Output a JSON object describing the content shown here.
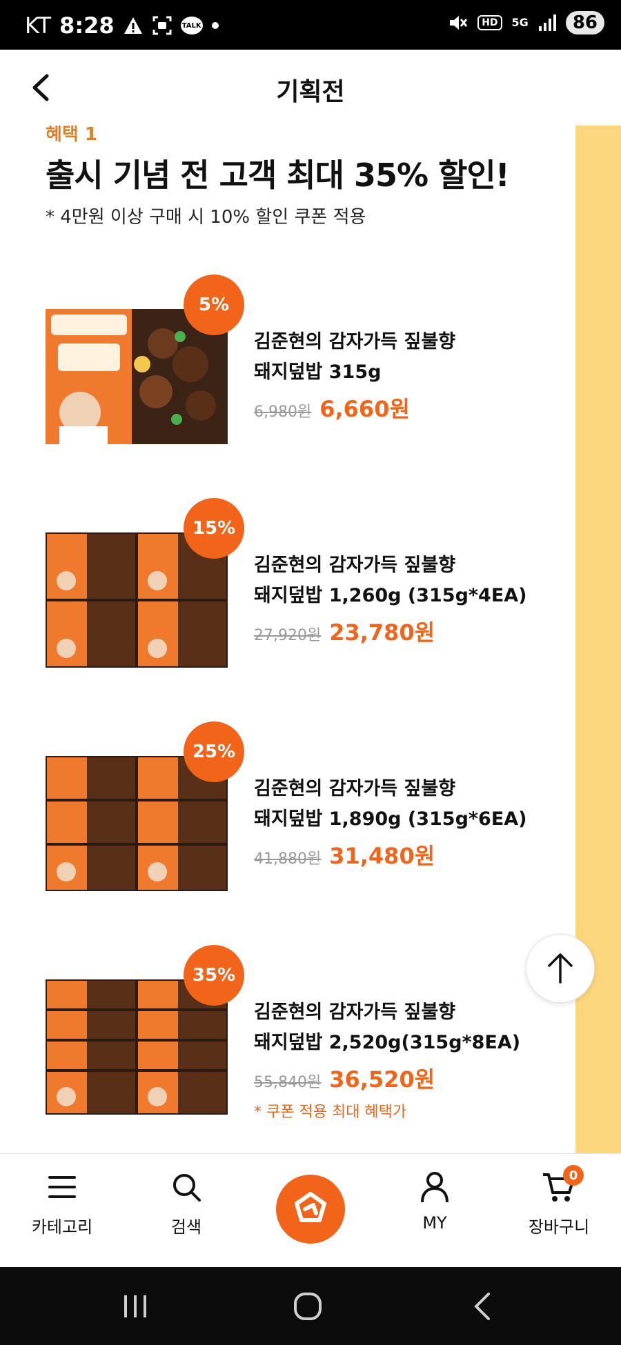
{
  "status_bar": {
    "carrier": "KT",
    "time": "8:28",
    "talk_label": "TALK",
    "battery": "86",
    "hd": "HD",
    "five_g": "5G"
  },
  "header": {
    "title": "기획전"
  },
  "promo": {
    "cut_label": "혜택 1",
    "headline": "출시 기념 전 고객 최대 35% 할인!",
    "note": "* 4만원 이상 구매 시 10% 할인 쿠폰 적용"
  },
  "products": [
    {
      "badge": "5%",
      "name_line1": "김준현의 감자가득 짚불향",
      "name_line2": "돼지덮밥 315g",
      "old_price": "6,980원",
      "new_price": "6,660원",
      "pack_count": 1
    },
    {
      "badge": "15%",
      "name_line1": "김준현의 감자가득 짚불향",
      "name_line2": "돼지덮밥 1,260g (315g*4EA)",
      "old_price": "27,920원",
      "new_price": "23,780원",
      "pack_count": 4
    },
    {
      "badge": "25%",
      "name_line1": "김준현의 감자가득 짚불향",
      "name_line2": "돼지덮밥 1,890g (315g*6EA)",
      "old_price": "41,880원",
      "new_price": "31,480원",
      "pack_count": 6
    },
    {
      "badge": "35%",
      "name_line1": "김준현의 감자가득 짚불향",
      "name_line2": "돼지덮밥 2,520g(315g*8EA)",
      "old_price": "55,840원",
      "new_price": "36,520원",
      "coupon_note": "* 쿠폰 적용 최대 혜택가",
      "pack_count": 8
    }
  ],
  "bottom_nav": {
    "category": "카테고리",
    "search": "검색",
    "my": "MY",
    "cart": "장바구니",
    "cart_count": "0"
  },
  "colors": {
    "accent": "#f26419",
    "side_band": "#fdd77e"
  }
}
